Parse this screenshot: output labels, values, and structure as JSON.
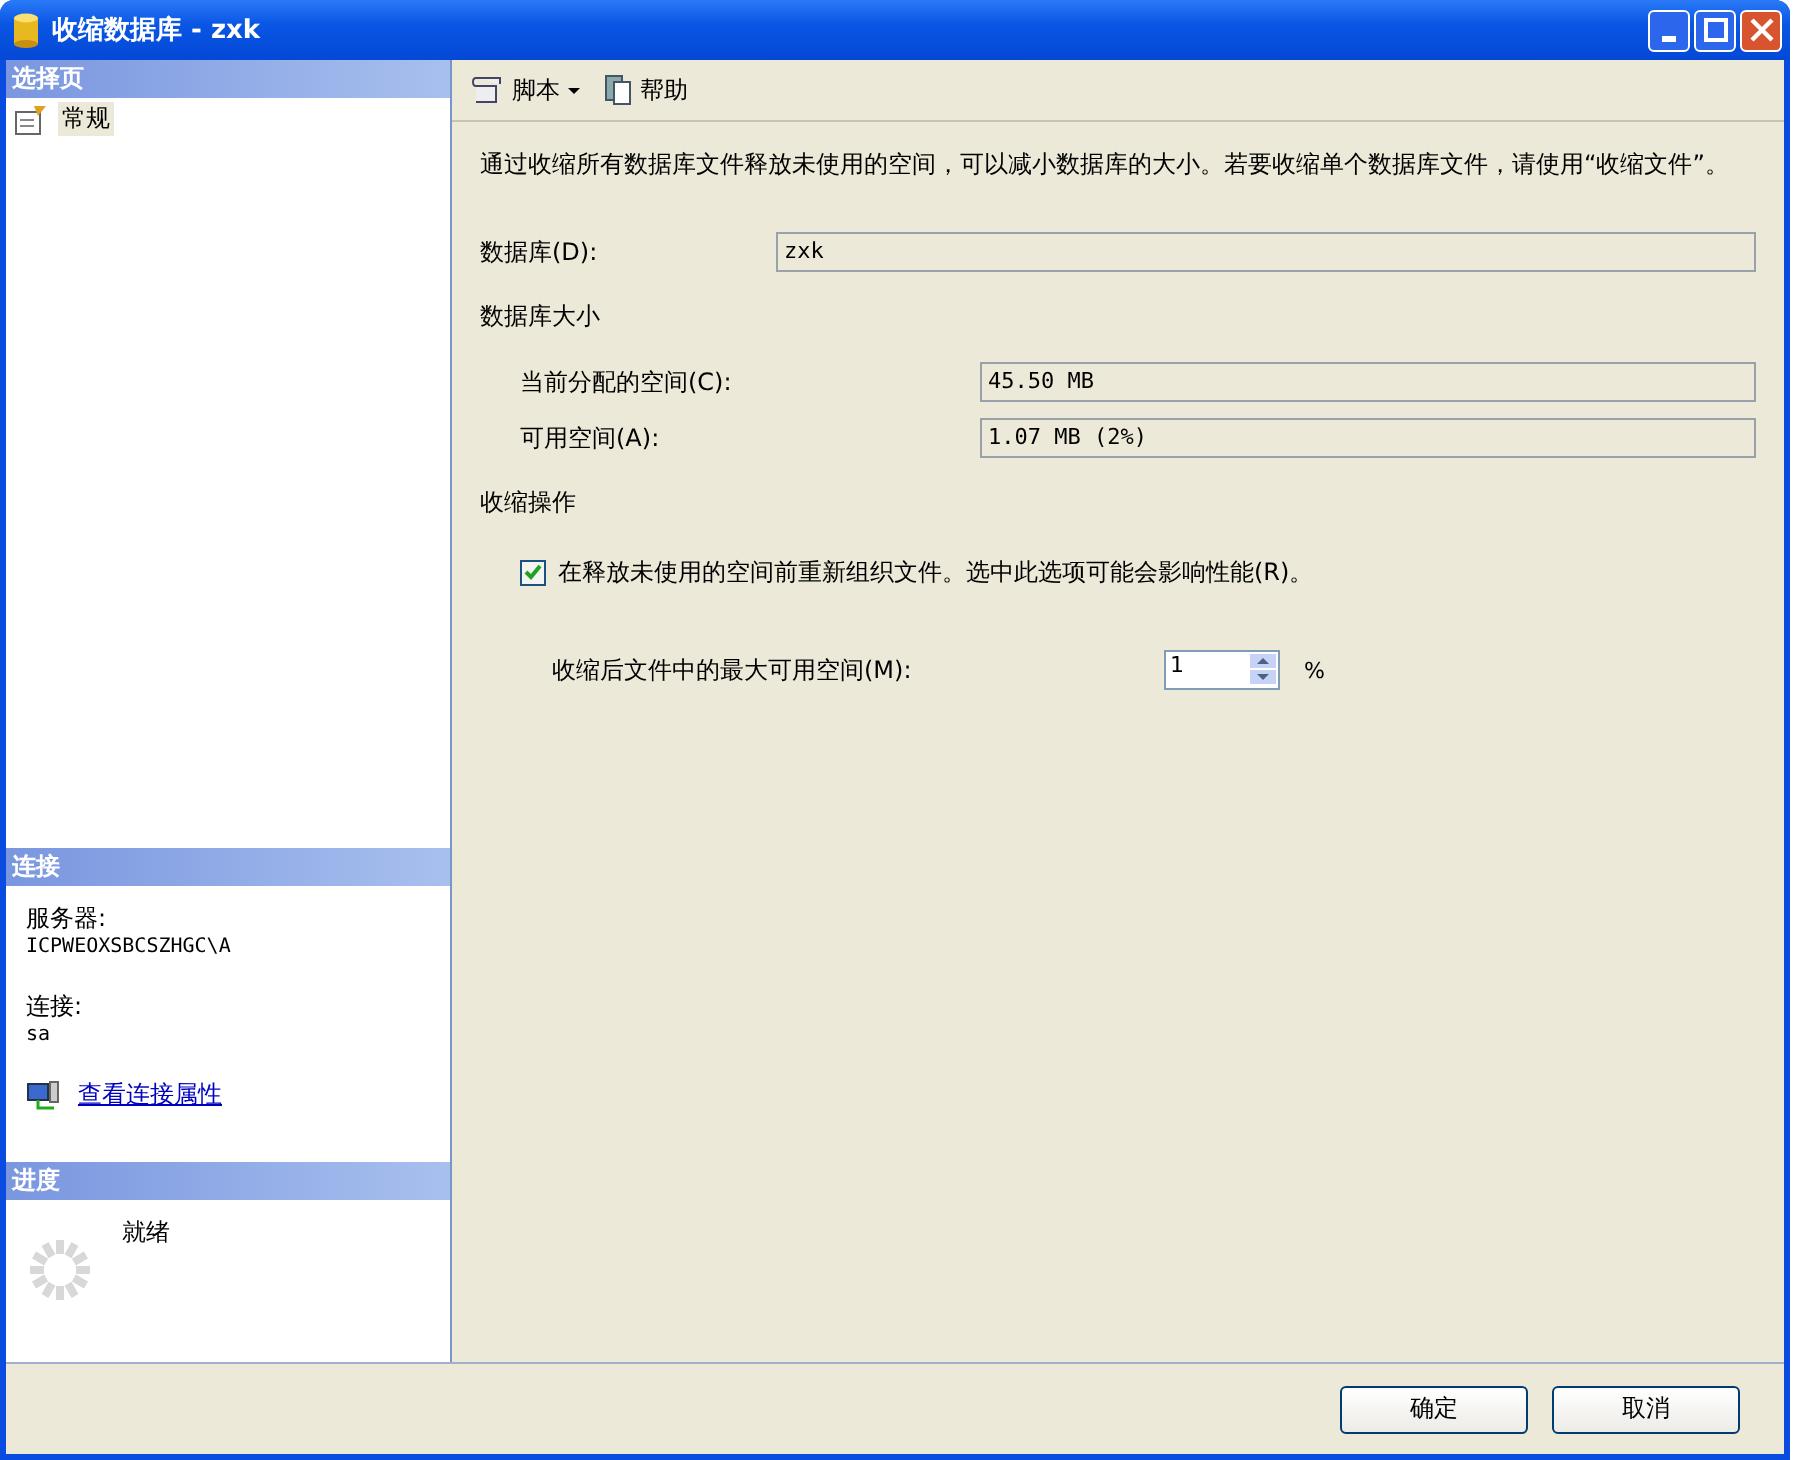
{
  "window": {
    "title": "收缩数据库 - zxk"
  },
  "sidebar": {
    "select_page": {
      "header": "选择页",
      "items": [
        {
          "label": "常规",
          "selected": true
        }
      ]
    },
    "connection": {
      "header": "连接",
      "server_label": "服务器:",
      "server": "ICPWEOXSBCSZHGC\\A",
      "conn_label": "连接:",
      "conn": "sa",
      "link": "查看连接属性"
    },
    "progress": {
      "header": "进度",
      "status": "就绪"
    }
  },
  "toolbar": {
    "script": "脚本",
    "help": "帮助"
  },
  "description": "通过收缩所有数据库文件释放未使用的空间，可以减小数据库的大小。若要收缩单个数据库文件，请使用“收缩文件”。",
  "database": {
    "label": "数据库(D):",
    "value": "zxk"
  },
  "size": {
    "header": "数据库大小",
    "allocated_label": "当前分配的空间(C):",
    "allocated": "45.50 MB",
    "free_label": "可用空间(A):",
    "free": "1.07 MB (2%)"
  },
  "shrink": {
    "header": "收缩操作",
    "reorganize": {
      "label": "在释放未使用的空间前重新组织文件。选中此选项可能会影响性能(R)。",
      "checked": true
    },
    "max_free_label": "收缩后文件中的最大可用空间(M):",
    "max_free": "1",
    "unit": "%"
  },
  "buttons": [
    "确定",
    "取消"
  ]
}
